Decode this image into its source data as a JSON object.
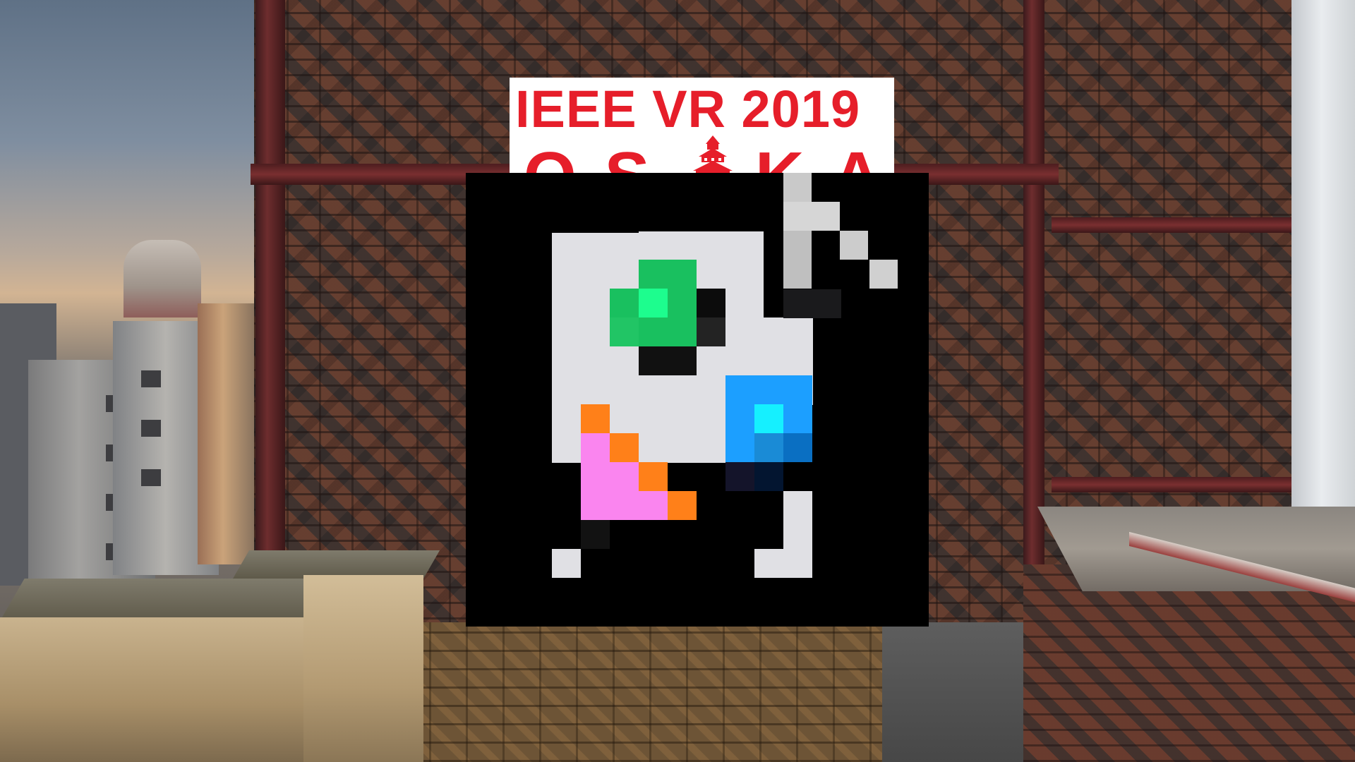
{
  "poster": {
    "title": "IEEE VR 2019",
    "subtitle": "OSAKA"
  },
  "pixel_art": {
    "colors": {
      "background": "#000000",
      "body": "#e0e0e4",
      "green": "#19c05f",
      "green_highlight": "#1dfd8e",
      "blue": "#1c9fff",
      "blue_highlight": "#15f0ff",
      "pink": "#fa85ef",
      "orange": "#ff8019",
      "gray": "#c0c0c0"
    }
  },
  "scene": {
    "brand_color": "#e61e2a"
  }
}
